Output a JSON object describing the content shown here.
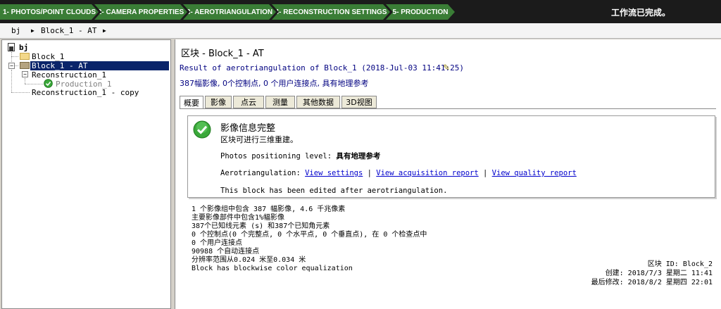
{
  "workflow": {
    "steps": [
      {
        "label": "1- PHOTOS/POINT CLOUDS"
      },
      {
        "label": "2- CAMERA PROPERTIES"
      },
      {
        "label": "3- AEROTRIANGULATION"
      },
      {
        "label": "4- RECONSTRUCTION SETTINGS"
      },
      {
        "label": "5- PRODUCTION"
      }
    ],
    "status": "工作流已完成。"
  },
  "breadcrumb": {
    "items": [
      "bj",
      "Block_1 - AT"
    ]
  },
  "tree": {
    "root": "bj",
    "block": "Block_1",
    "block_at": "Block_1 - AT",
    "reconstruction": "Reconstruction_1",
    "production": "Production_1",
    "reconstruction_copy": "Reconstruction_1 - copy"
  },
  "main": {
    "title": "区块 - Block_1 - AT",
    "result_line": "Result of aerotriangulation of Block_1 (2018-Jul-03 11:41:25)",
    "summary_line": "387幅影像, 0个控制点, 0 个用户连接点, 具有地理参考",
    "tabs": [
      {
        "label": "概要"
      },
      {
        "label": "影像"
      },
      {
        "label": "点云"
      },
      {
        "label": "测量"
      },
      {
        "label": "其他数据"
      },
      {
        "label": "3D视图"
      }
    ],
    "info": {
      "heading": "影像信息完整",
      "subheading": "区块可进行三维重建。",
      "positioning_label": "Photos positioning level: ",
      "positioning_value": "具有地理参考",
      "at_label": "Aerotriangulation: ",
      "link_settings": "View settings",
      "link_acquisition": "View acquisition report",
      "link_quality": "View quality report",
      "separator": "|",
      "edited_note": "This block has been edited after aerotriangulation."
    },
    "stats": [
      "1 个影像组中包含 387 幅影像, 4.6 千兆像素",
      "主要影像部件中包含1%幅影像",
      "387个已知线元素 (s) 和387个已知角元素",
      "0 个控制点(0 个完整点, 0 个水平点, 0 个垂直点), 在 0 个检查点中",
      "0 个用户连接点",
      "90988 个自动连接点",
      "分辨率范围从0.024 米至0.034 米",
      "Block has blockwise color equalization"
    ],
    "meta": {
      "block_id": "区块 ID: Block_2",
      "created": "创建: 2018/7/3 星期二 11:41",
      "modified": "最后修改: 2018/8/2 星期四 22:01"
    }
  },
  "colors": {
    "workflow_step": "#3a7d36",
    "workflow_bar": "#1b1b1b",
    "selection": "#0a246a",
    "link": "#0000cc",
    "check": "#3aa83a"
  }
}
